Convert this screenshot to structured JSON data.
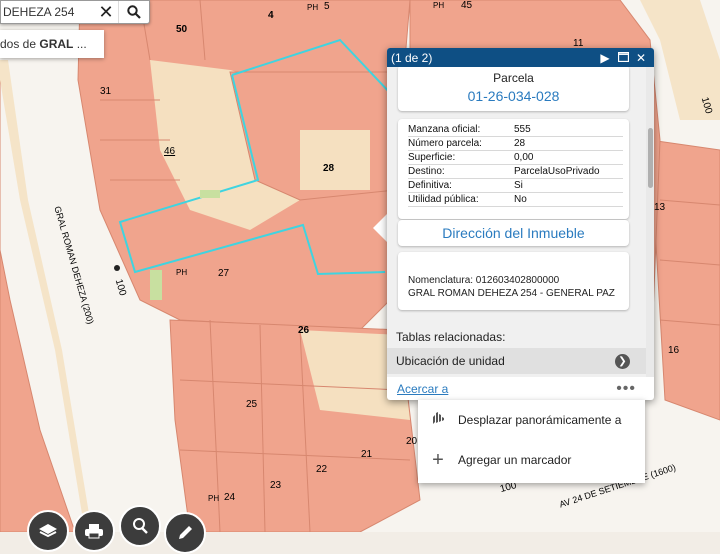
{
  "search": {
    "value": "DEHEZA 254",
    "suggestion_prefix": "dos de ",
    "suggestion_bold": "GRAL",
    "suggestion_suffix": " ..."
  },
  "map": {
    "block_numbers": [
      "50",
      "4",
      "5",
      "45",
      "11",
      "31",
      "46",
      "28",
      "27",
      "26",
      "25",
      "21",
      "22",
      "23",
      "24",
      "20",
      "13",
      "16"
    ],
    "ph_labels": [
      "PH",
      "PH",
      "PH",
      "PH"
    ],
    "street_labels": {
      "gral_roman_deheza": "GRAL ROMAN DEHEZA (200)",
      "address_100_left": "100",
      "address_100_right": "100",
      "address_100_bottom": "100",
      "septiembre": "AV 24 DE SETIEMBRE (1600)"
    },
    "colors": {
      "parcel": "#f0a48d",
      "sidewalk": "#f5e4c8",
      "highlight": "#3fd4e0"
    }
  },
  "popup": {
    "count": "(1 de 2)",
    "title": "Parcela",
    "parcel_id": "01-26-034-028",
    "attributes": [
      {
        "k": "Manzana oficial:",
        "v": "555"
      },
      {
        "k": "Número parcela:",
        "v": "28"
      },
      {
        "k": "Superficie:",
        "v": "0,00"
      },
      {
        "k": "Destino:",
        "v": "ParcelaUsoPrivado"
      },
      {
        "k": "Definitiva:",
        "v": "Si"
      },
      {
        "k": "Utilidad pública:",
        "v": "No"
      }
    ],
    "direccion": "Dirección del Inmueble",
    "nomenclatura": "Nomenclatura: 012603402800000",
    "address": "GRAL ROMAN DEHEZA 254 - GENERAL PAZ",
    "tablas_label": "Tablas relacionadas:",
    "ubicacion_label": "Ubicación de unidad",
    "acercar": "Acercar a",
    "more": "•••"
  },
  "menu": {
    "pan_label": "Desplazar panorámicamente a",
    "marker_label": "Agregar un marcador"
  }
}
